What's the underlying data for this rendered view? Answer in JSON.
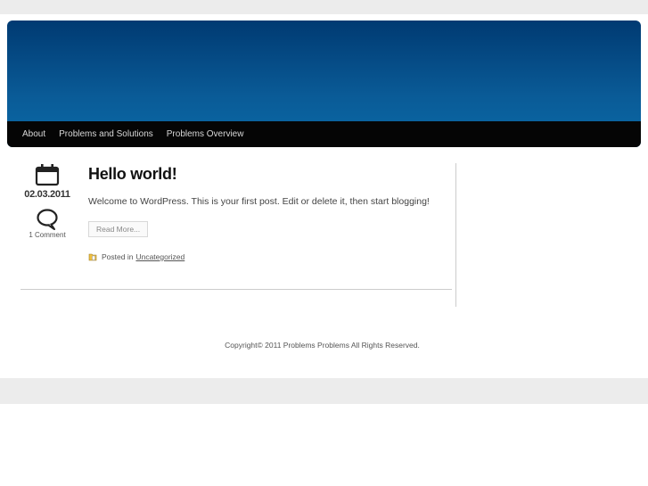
{
  "nav": {
    "items": [
      {
        "label": "About"
      },
      {
        "label": "Problems and Solutions"
      },
      {
        "label": "Problems Overview"
      }
    ]
  },
  "post": {
    "date": "02.03.2011",
    "comments": "1 Comment",
    "title": "Hello world!",
    "body": "Welcome to WordPress. This is your first post. Edit or delete it, then start blogging!",
    "read_more": "Read More...",
    "posted_in_label": "Posted in",
    "category": "Uncategorized"
  },
  "footer": {
    "copyright": "Copyright© 2011 Problems Problems All Rights Reserved."
  },
  "colors": {
    "header_top": "#003a72",
    "header_bottom": "#0a6aa7",
    "nav_bg": "#050505"
  }
}
